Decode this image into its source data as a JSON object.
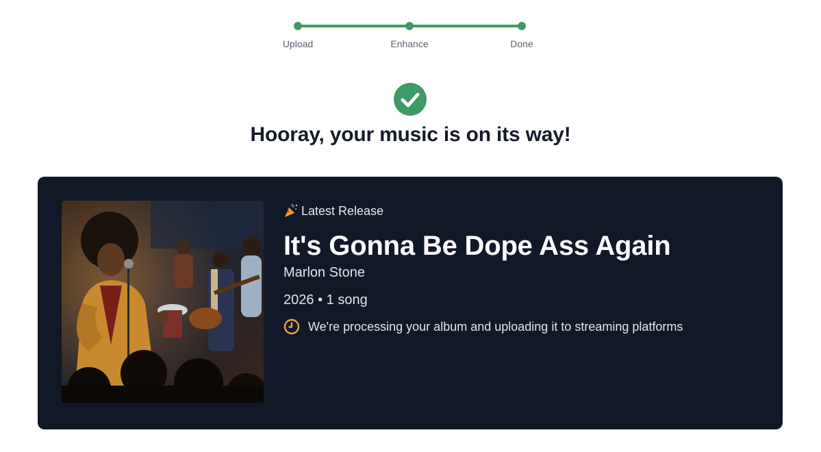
{
  "stepper": {
    "steps": [
      {
        "label": "Upload",
        "done": true
      },
      {
        "label": "Enhance",
        "done": true
      },
      {
        "label": "Done",
        "done": true
      }
    ],
    "color": "#3f9a65"
  },
  "success": {
    "icon": "check-circle-icon",
    "headline": "Hooray, your music is on its way!"
  },
  "release": {
    "badge_icon": "party-popper-icon",
    "badge_label": "Latest Release",
    "title": "It's Gonna Be Dope Ass Again",
    "artist": "Marlon Stone",
    "year": "2026",
    "separator": "•",
    "song_count": "1 song",
    "status_icon": "clock-icon",
    "status_text": "We're processing your album and uploading it to streaming platforms",
    "cover_alt": "Album cover artwork",
    "card_color": "#111827",
    "accent_color": "#f2a24a"
  }
}
